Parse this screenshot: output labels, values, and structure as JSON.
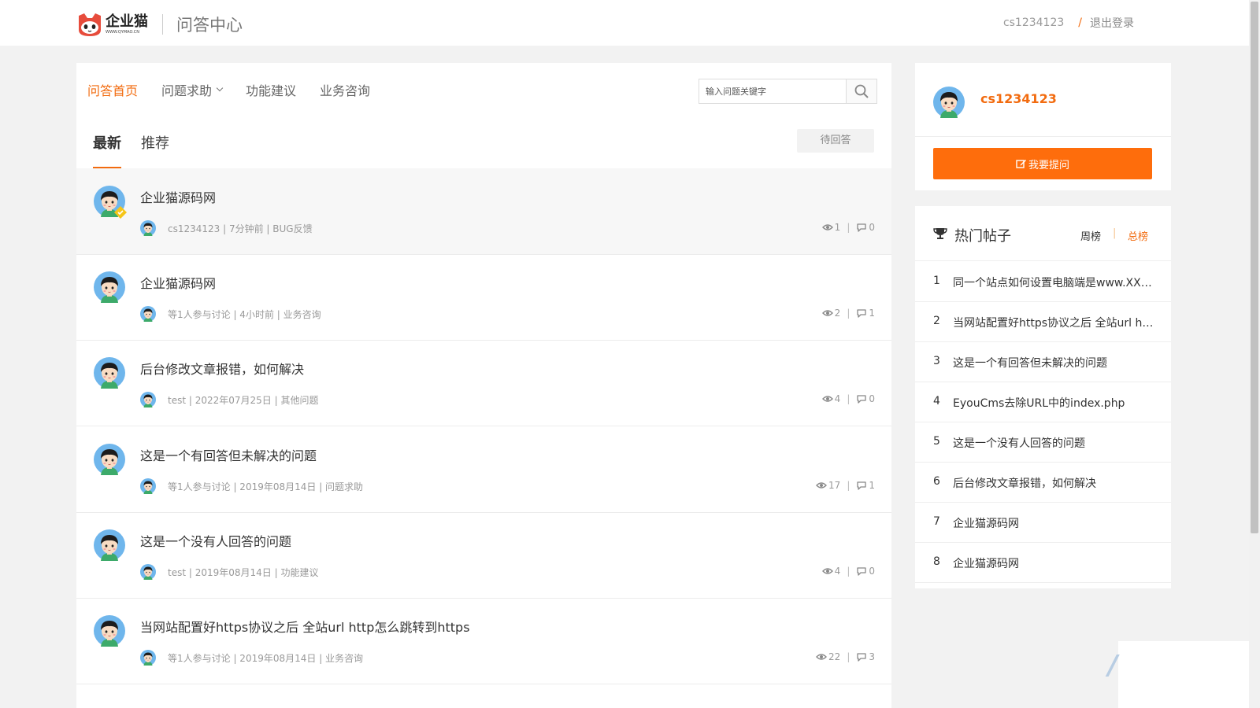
{
  "header": {
    "brand_name": "企业猫",
    "brand_url": "WWW.QYMAO.CN",
    "section_title": "问答中心",
    "username": "cs1234123",
    "separator": "/",
    "logout_label": "退出登录"
  },
  "nav": {
    "items": [
      "问答首页",
      "问题求助",
      "功能建议",
      "业务咨询"
    ],
    "active_index": 0
  },
  "search": {
    "placeholder": "输入问题关键字"
  },
  "tabs": {
    "latest": "最新",
    "recommend": "推荐",
    "pending_button": "待回答"
  },
  "posts": [
    {
      "title": "企业猫源码网",
      "meta": "cs1234123 | 7分钟前 | BUG反馈",
      "views": "1",
      "answers": "0"
    },
    {
      "title": "企业猫源码网",
      "meta": "等1人参与讨论 | 4小时前 | 业务咨询",
      "views": "2",
      "answers": "1"
    },
    {
      "title": "后台修改文章报错，如何解决",
      "meta": "test | 2022年07月25日 | 其他问题",
      "views": "4",
      "answers": "0"
    },
    {
      "title": "这是一个有回答但未解决的问题",
      "meta": "等1人参与讨论 | 2019年08月14日 | 问题求助",
      "views": "17",
      "answers": "1"
    },
    {
      "title": "这是一个没有人回答的问题",
      "meta": "test | 2019年08月14日 | 功能建议",
      "views": "4",
      "answers": "0"
    },
    {
      "title": "当网站配置好https协议之后 全站url http怎么跳转到https",
      "meta": "等1人参与讨论 | 2019年08月14日 | 业务咨询",
      "views": "22",
      "answers": "3"
    }
  ],
  "sidebar": {
    "username": "cs1234123",
    "ask_button": "我要提问",
    "hot_title": "热门帖子",
    "week_label": "周榜",
    "tab_separator": "|",
    "all_label": "总榜",
    "hot_items": [
      {
        "num": "1",
        "text": "同一个站点如何设置电脑端是www.XXX.com…"
      },
      {
        "num": "2",
        "text": "当网站配置好https协议之后 全站url http怎么跳转到https"
      },
      {
        "num": "3",
        "text": "这是一个有回答但未解决的问题"
      },
      {
        "num": "4",
        "text": "EyouCms去除URL中的index.php"
      },
      {
        "num": "5",
        "text": "这是一个没有人回答的问题"
      },
      {
        "num": "6",
        "text": "后台修改文章报错，如何解决"
      },
      {
        "num": "7",
        "text": "企业猫源码网"
      },
      {
        "num": "8",
        "text": "企业猫源码网"
      }
    ]
  },
  "colors": {
    "accent": "#f26b0f",
    "button": "#fe6d0c",
    "background": "#f2f2f2"
  }
}
